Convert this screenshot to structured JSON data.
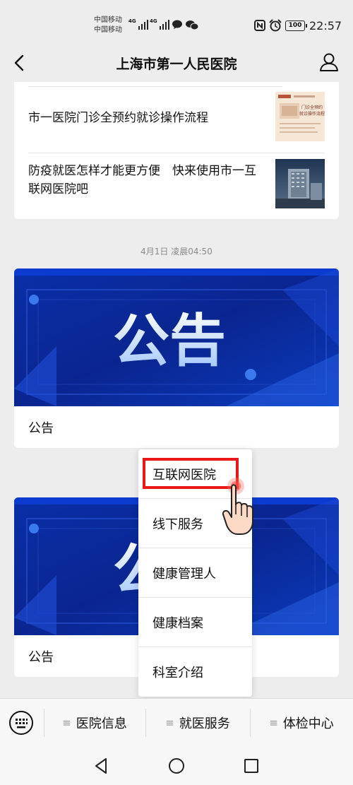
{
  "status_bar": {
    "carrier_1": "中国移动",
    "carrier_2": "中国移动",
    "network_1": "4G",
    "network_2": "4G",
    "battery": "100",
    "time": "22:57"
  },
  "nav": {
    "title": "上海市第一人民医院"
  },
  "articles": [
    {
      "title": "市一医院门诊全预约就诊操作流程",
      "thumb_text": "门诊全预约\n就诊操作流程"
    },
    {
      "title": "防疫就医怎样才能更方便　快来使用市一互联网医院吧"
    }
  ],
  "messages": {
    "timestamp": "4月1日 凌晨04:50",
    "partial_timestamp": "4",
    "banner_text": "公告",
    "cards": [
      {
        "label": "公告"
      },
      {
        "label": "公告"
      }
    ]
  },
  "popup_menu": {
    "items": [
      {
        "label": "互联网医院",
        "highlighted": true
      },
      {
        "label": "线下服务"
      },
      {
        "label": "健康管理人"
      },
      {
        "label": "健康档案"
      },
      {
        "label": "科室介绍"
      }
    ]
  },
  "bottom_menu": {
    "items": [
      {
        "label": "医院信息"
      },
      {
        "label": "就医服务"
      },
      {
        "label": "体检中心"
      }
    ]
  },
  "colors": {
    "background": "#ededed",
    "banner_blue": "#0a2a9c",
    "highlight_red": "#e81818"
  }
}
